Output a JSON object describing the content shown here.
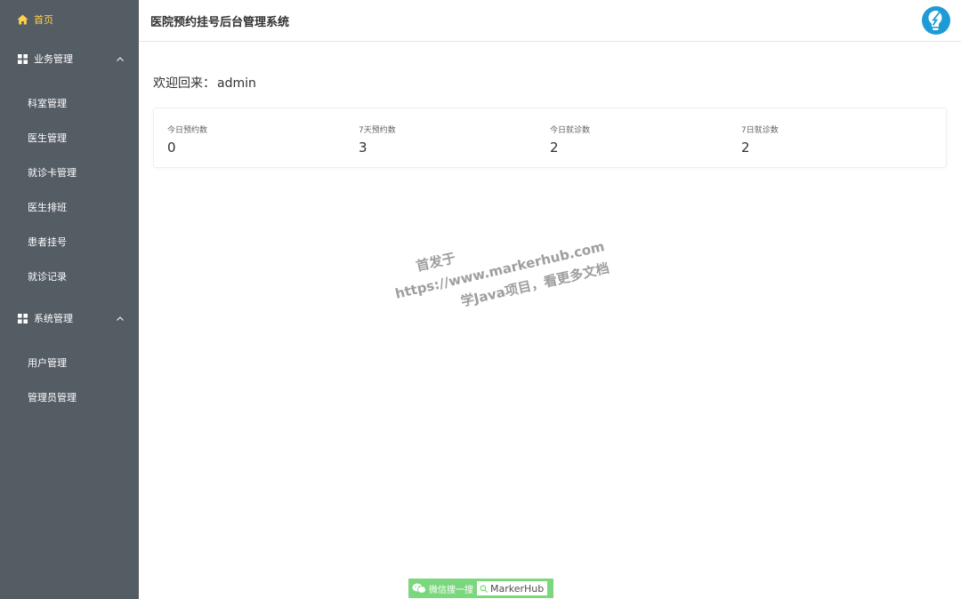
{
  "sidebar": {
    "home_label": "首页",
    "groups": [
      {
        "label": "业务管理",
        "items": [
          "科室管理",
          "医生管理",
          "就诊卡管理",
          "医生排班",
          "患者挂号",
          "就诊记录"
        ]
      },
      {
        "label": "系统管理",
        "items": [
          "用户管理",
          "管理员管理"
        ]
      }
    ]
  },
  "header": {
    "title": "医院预约挂号后台管理系统"
  },
  "main": {
    "welcome_label": "欢迎回来：",
    "username": "admin",
    "stats": [
      {
        "title": "今日预约数",
        "value": "0"
      },
      {
        "title": "7天预约数",
        "value": "3"
      },
      {
        "title": "今日就诊数",
        "value": "2"
      },
      {
        "title": "7日就诊数",
        "value": "2"
      }
    ]
  },
  "watermark": {
    "line1": "首发于",
    "line2": "https://www.markerhub.com",
    "line3": "学Java项目，看更多文档"
  },
  "badge": {
    "text": "微信搜一搜",
    "search_text": "MarkerHub"
  },
  "colors": {
    "sidebar_bg": "#545c64",
    "active": "#ffd04b",
    "avatar": "#1e9bd7",
    "badge": "#7bd77e"
  }
}
